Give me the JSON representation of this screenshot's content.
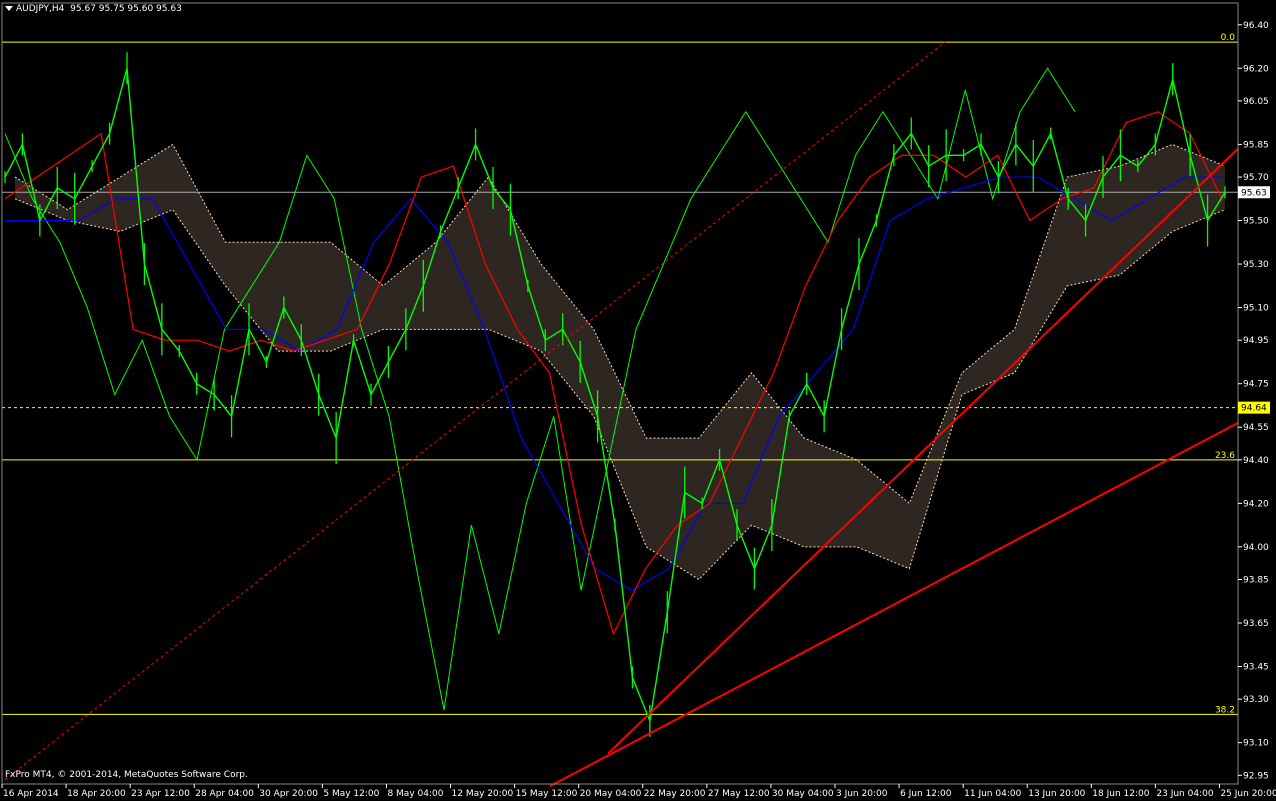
{
  "header": {
    "symbol": "AUDJPY,H4",
    "ohlc": "95.67 95.75 95.60 95.63"
  },
  "copyright": "FxPro MT4, © 2001-2014, MetaQuotes Software Corp.",
  "colors": {
    "background": "#000000",
    "price": "#00ff00",
    "chikou": "#00ff00",
    "tenkan": "#ff0000",
    "kijun": "#0000ff",
    "cloud": "#ffdab9",
    "fibo": "#ffff00",
    "trendline": "#ff0000",
    "axis_text": "#ffffff"
  },
  "chart_data": {
    "type": "line",
    "title": "",
    "price_axis": {
      "ticks": [
        "96.40",
        "96.20",
        "96.05",
        "95.85",
        "95.70",
        "95.50",
        "95.30",
        "95.10",
        "94.95",
        "94.75",
        "94.55",
        "94.40",
        "94.20",
        "94.00",
        "93.85",
        "93.65",
        "93.45",
        "93.30",
        "93.10",
        "92.95"
      ],
      "range": [
        92.91,
        96.5
      ]
    },
    "time_axis": {
      "ticks": [
        "16 Apr 2014",
        "18 Apr 20:00",
        "23 Apr 12:00",
        "28 Apr 04:00",
        "30 Apr 20:00",
        "5 May 12:00",
        "8 May 04:00",
        "12 May 20:00",
        "15 May 12:00",
        "20 May 04:00",
        "22 May 20:00",
        "27 May 12:00",
        "30 May 04:00",
        "3 Jun 20:00",
        "6 Jun 12:00",
        "11 Jun 04:00",
        "13 Jun 20:00",
        "18 Jun 12:00",
        "23 Jun 04:00",
        "25 Jun 20:00"
      ]
    },
    "current_price": {
      "label": "95.63",
      "value": 95.63
    },
    "marked_level": {
      "label": "94.64",
      "value": 94.64
    },
    "fibonacci": [
      {
        "label": "0.0",
        "value": 96.32
      },
      {
        "label": "23.6",
        "value": 94.4
      },
      {
        "label": "38.2",
        "value": 93.23
      }
    ],
    "series": [
      {
        "name": "price",
        "values": [
          95.7,
          95.85,
          95.5,
          95.65,
          95.6,
          95.75,
          95.9,
          96.2,
          95.3,
          95.0,
          94.9,
          94.75,
          94.7,
          94.6,
          95.0,
          94.85,
          95.1,
          94.95,
          94.7,
          94.5,
          94.95,
          94.7,
          94.85,
          95.0,
          95.2,
          95.45,
          95.65,
          95.85,
          95.65,
          95.55,
          95.2,
          94.95,
          95.0,
          94.85,
          94.6,
          94.1,
          93.4,
          93.2,
          93.7,
          94.25,
          94.2,
          94.4,
          94.1,
          93.9,
          94.1,
          94.6,
          94.75,
          94.6,
          95.0,
          95.3,
          95.5,
          95.8,
          95.9,
          95.75,
          95.8,
          95.8,
          95.85,
          95.7,
          95.85,
          95.75,
          95.9,
          95.6,
          95.5,
          95.7,
          95.8,
          95.75,
          95.85,
          96.15,
          95.8,
          95.5,
          95.63
        ]
      },
      {
        "name": "chikou",
        "values": [
          95.9,
          95.6,
          95.4,
          95.1,
          94.7,
          94.95,
          94.6,
          94.4,
          95.0,
          95.2,
          95.4,
          95.8,
          95.6,
          95.0,
          94.6,
          93.9,
          93.25,
          94.1,
          93.6,
          94.2,
          94.6,
          93.8,
          94.4,
          95.0,
          95.3,
          95.6,
          95.8,
          96.0,
          95.8,
          95.6,
          95.4,
          95.8,
          96.0,
          95.8,
          95.6,
          96.1,
          95.6,
          96.0,
          96.2,
          96.0
        ]
      },
      {
        "name": "tenkan",
        "values": [
          95.6,
          95.7,
          95.8,
          95.9,
          95.0,
          94.95,
          94.95,
          94.9,
          94.95,
          94.9,
          94.95,
          95.0,
          95.3,
          95.7,
          95.75,
          95.3,
          95.0,
          94.8,
          94.1,
          93.6,
          93.9,
          94.1,
          94.2,
          94.5,
          94.8,
          95.2,
          95.5,
          95.7,
          95.8,
          95.8,
          95.7,
          95.8,
          95.5,
          95.6,
          95.65,
          95.95,
          96.0,
          95.9,
          95.6
        ]
      },
      {
        "name": "kijun",
        "values": [
          95.5,
          95.5,
          95.5,
          95.6,
          95.6,
          95.3,
          95.0,
          95.0,
          94.9,
          95.0,
          95.4,
          95.6,
          95.4,
          95.0,
          94.5,
          94.2,
          93.9,
          93.8,
          93.9,
          94.2,
          94.2,
          94.6,
          94.8,
          95.0,
          95.5,
          95.6,
          95.65,
          95.7,
          95.7,
          95.6,
          95.5,
          95.6,
          95.7,
          95.7
        ]
      },
      {
        "name": "cloud_upper",
        "values": [
          95.7,
          95.55,
          95.7,
          95.85,
          95.4,
          95.4,
          95.4,
          95.2,
          95.4,
          95.7,
          95.3,
          95.0,
          94.5,
          94.5,
          94.8,
          94.5,
          94.4,
          94.2,
          94.8,
          95.0,
          95.7,
          95.75,
          95.85,
          95.75
        ]
      },
      {
        "name": "cloud_lower",
        "values": [
          95.6,
          95.5,
          95.45,
          95.55,
          95.2,
          94.9,
          94.9,
          95.0,
          95.0,
          95.0,
          94.9,
          94.6,
          94.0,
          93.85,
          94.1,
          94.0,
          94.0,
          93.9,
          94.7,
          94.8,
          95.2,
          95.25,
          95.45,
          95.55
        ]
      }
    ]
  }
}
